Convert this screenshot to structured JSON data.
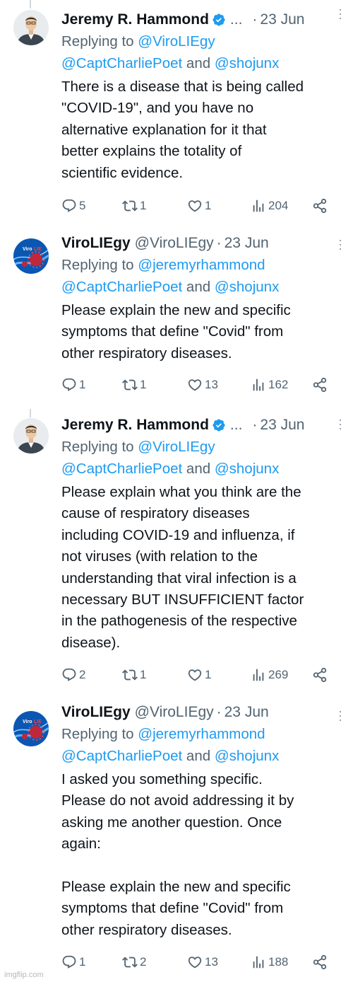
{
  "tweets": [
    {
      "author": "Jeremy R. Hammond",
      "handle": "",
      "truncated": "...",
      "date": "23 Jun",
      "reply_prefix": "Replying to ",
      "reply_line1": "@ViroLIEgy",
      "reply_line2_a": "@CaptCharliePoet",
      "reply_and": " and ",
      "reply_line2_b": "@shojunx",
      "text": "There is a disease that is being called\n\"COVID-19\", and you have no\nalternative explanation for it that\nbetter explains the totality of\nscientific evidence.",
      "replies": "5",
      "retweets": "1",
      "likes": "1",
      "views": "204"
    },
    {
      "author": "ViroLIEgy",
      "handle": "@ViroLIEgy",
      "truncated": "",
      "date": "23 Jun",
      "reply_prefix": "Replying to ",
      "reply_line1": "@jeremyrhammond",
      "reply_line2_a": "@CaptCharliePoet",
      "reply_and": " and ",
      "reply_line2_b": "@shojunx",
      "text": "Please explain the new and specific\nsymptoms that define \"Covid\" from\nother respiratory diseases.",
      "replies": "1",
      "retweets": "1",
      "likes": "13",
      "views": "162"
    },
    {
      "author": "Jeremy R. Hammond",
      "handle": "",
      "truncated": "...",
      "date": "23 Jun",
      "reply_prefix": "Replying to ",
      "reply_line1": "@ViroLIEgy",
      "reply_line2_a": "@CaptCharliePoet",
      "reply_and": " and ",
      "reply_line2_b": "@shojunx",
      "text": "Please explain what you think are the\ncause of respiratory diseases\nincluding COVID-19 and influenza, if\nnot viruses (with relation to the\nunderstanding that viral infection is a\nnecessary BUT INSUFFICIENT factor\nin the pathogenesis of the respective\ndisease).",
      "replies": "2",
      "retweets": "1",
      "likes": "1",
      "views": "269"
    },
    {
      "author": "ViroLIEgy",
      "handle": "@ViroLIEgy",
      "truncated": "",
      "date": "23 Jun",
      "reply_prefix": "Replying to ",
      "reply_line1": "@jeremyrhammond",
      "reply_line2_a": "@CaptCharliePoet",
      "reply_and": " and ",
      "reply_line2_b": "@shojunx",
      "text": "I asked you something specific.\nPlease do not avoid addressing it by\nasking me another question. Once\nagain:\n\nPlease explain the new and specific\nsymptoms that define \"Covid\" from\nother respiratory diseases.",
      "replies": "1",
      "retweets": "2",
      "likes": "13",
      "views": "188"
    }
  ],
  "date_separator": "·",
  "watermark": "imgflip.com",
  "colors": {
    "text": "#0f1419",
    "secondary": "#536471",
    "link": "#1d9bf0",
    "verified": "#1d9bf0"
  },
  "icons": [
    "reply-icon",
    "retweet-icon",
    "like-icon",
    "views-icon",
    "share-icon",
    "verified-badge-icon",
    "more-options-icon"
  ]
}
